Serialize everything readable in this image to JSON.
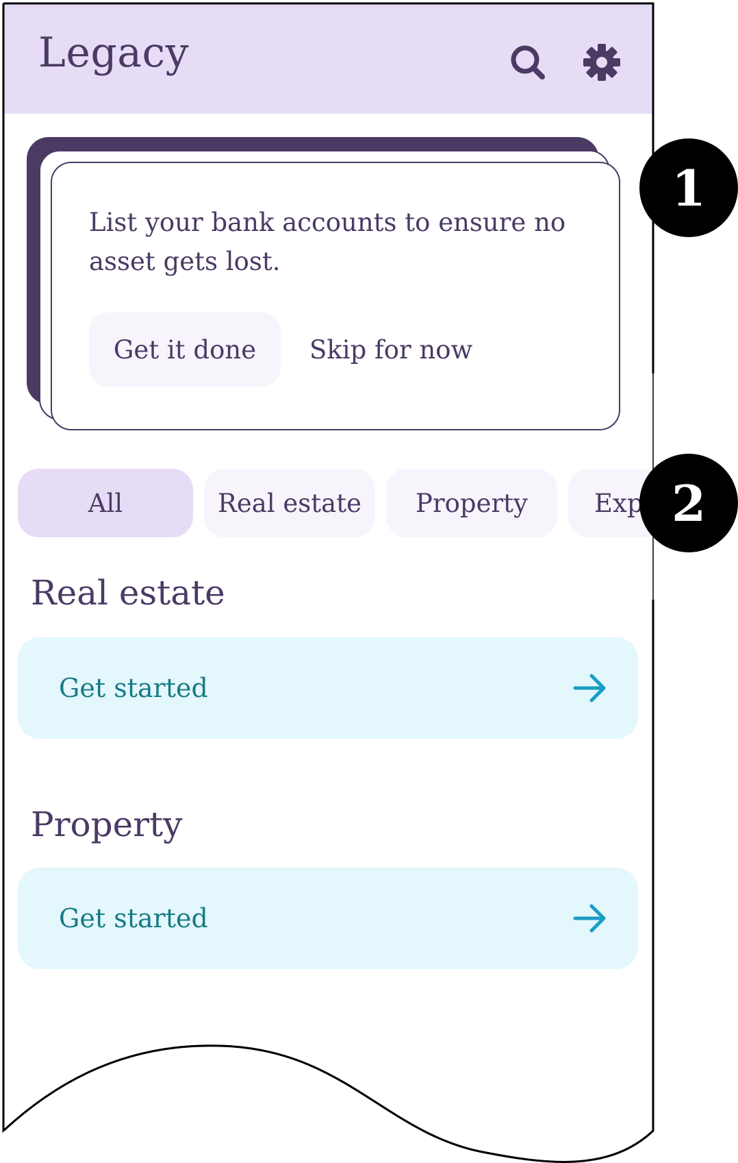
{
  "header": {
    "title": "Legacy",
    "search_icon": "search-icon",
    "settings_icon": "gear-icon",
    "background": "#e6dcf6"
  },
  "prompt_card": {
    "message": "List your bank accounts to ensure no asset gets lost.",
    "primary_label": "Get it done",
    "secondary_label": "Skip for now"
  },
  "filters": {
    "chips": [
      {
        "label": "All",
        "active": true
      },
      {
        "label": "Real estate",
        "active": false
      },
      {
        "label": "Property",
        "active": false
      },
      {
        "label": "Exp",
        "active": false
      }
    ]
  },
  "sections": [
    {
      "title": "Real estate",
      "cta_label": "Get started",
      "arrow_icon": "arrow-right-icon"
    },
    {
      "title": "Property",
      "cta_label": "Get started",
      "arrow_icon": "arrow-right-icon"
    }
  ],
  "annotations": {
    "marker_1": "1",
    "marker_2": "2"
  },
  "colors": {
    "primary_text": "#4a3a64",
    "accent_teal": "#177a86",
    "arrow_blue": "#1a9cc4",
    "cta_bg": "#e3f7fc",
    "chip_bg": "#f7f4fc"
  }
}
